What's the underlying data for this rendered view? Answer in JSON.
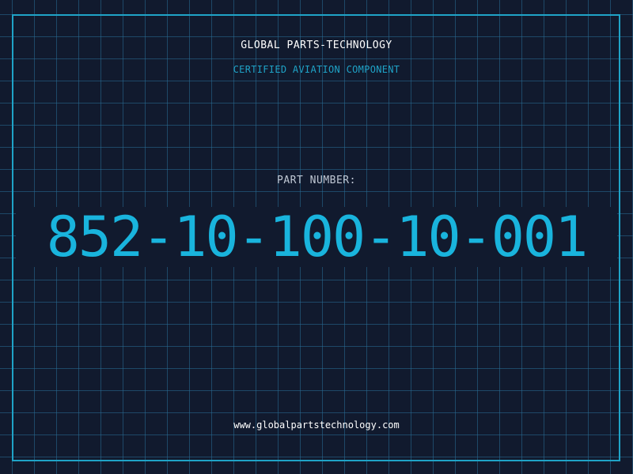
{
  "company": {
    "name": "GLOBAL PARTS-TECHNOLOGY",
    "tagline": "CERTIFIED AVIATION COMPONENT"
  },
  "part": {
    "label": "PART NUMBER:",
    "number": "852-10-100-10-001"
  },
  "footer": {
    "website": "www.globalpartstechnology.com"
  },
  "colors": {
    "background": "#111a2e",
    "grid": "#286e96",
    "accent": "#1fa3c7",
    "part_number": "#19b4dd",
    "text": "#ffffff"
  }
}
